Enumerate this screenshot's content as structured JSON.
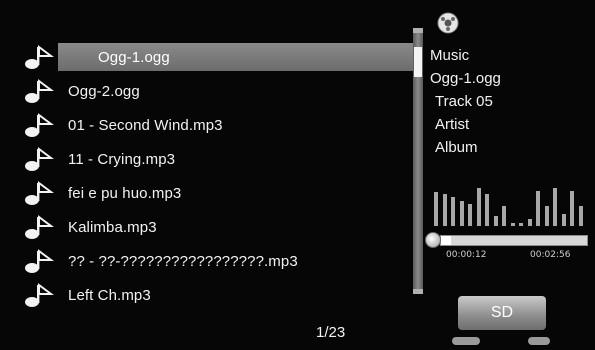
{
  "playlist": {
    "tracks": [
      {
        "title": "Ogg-1.ogg",
        "selected": true
      },
      {
        "title": "Ogg-2.ogg",
        "selected": false
      },
      {
        "title": "01 - Second Wind.mp3",
        "selected": false
      },
      {
        "title": "11 - Crying.mp3",
        "selected": false
      },
      {
        "title": "fei e pu huo.mp3",
        "selected": false
      },
      {
        "title": "Kalimba.mp3",
        "selected": false
      },
      {
        "title": "?? - ??-?????????????????.mp3",
        "selected": false
      },
      {
        "title": "Left Ch.mp3",
        "selected": false
      }
    ],
    "scroll_fraction": 0.04
  },
  "page_indicator": "1/23",
  "info": {
    "category": "Music",
    "filename": "Ogg-1.ogg",
    "track": "Track 05",
    "artist": "Artist",
    "album": "Album"
  },
  "spectrum_levels": [
    0.85,
    0.8,
    0.72,
    0.62,
    0.55,
    0.95,
    0.8,
    0.25,
    0.5,
    0.08,
    0.08,
    0.18,
    0.88,
    0.5,
    0.95,
    0.3,
    0.88,
    0.5
  ],
  "playback": {
    "elapsed": "00:00:12",
    "total": "00:02:56",
    "progress": 0.068
  },
  "storage": {
    "button_label": "SD"
  },
  "colors": {
    "background": "#060606",
    "highlight": "#7a7a7a",
    "spectrum": "#a8a8a8"
  },
  "icons": {
    "track": "music-note-icon",
    "disc": "disc-icon"
  }
}
